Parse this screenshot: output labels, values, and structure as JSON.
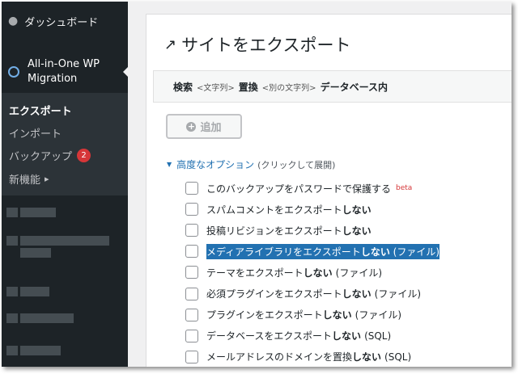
{
  "sidebar": {
    "dashboard": "ダッシュボード",
    "plugin": "All-in-One WP Migration",
    "submenu": {
      "export": "エクスポート",
      "import": "インポート",
      "backup": "バックアップ",
      "backup_count": "2",
      "new_features": "新機能"
    }
  },
  "main": {
    "title": "サイトをエクスポート",
    "search": {
      "search_label": "検索",
      "search_placeholder": "<文字列>",
      "replace_label": "置換",
      "replace_placeholder": "<別の文字列>",
      "suffix": "データベース内"
    },
    "add_button": "追加",
    "advanced": {
      "label": "高度なオプション",
      "hint": "(クリックして展開)"
    },
    "options": [
      {
        "text": "このバックアップをパスワードで保護する",
        "bold": "",
        "paren": "",
        "beta": "beta"
      },
      {
        "text": "スパムコメントをエクスポート",
        "bold": "しない",
        "paren": "",
        "beta": ""
      },
      {
        "text": "投稿リビジョンをエクスポート",
        "bold": "しない",
        "paren": "",
        "beta": ""
      },
      {
        "text": "メディアライブラリをエクスポート",
        "bold": "しない",
        "paren": "(ファイル)",
        "beta": "",
        "highlighted": true
      },
      {
        "text": "テーマをエクスポート",
        "bold": "しない",
        "paren": "(ファイル)",
        "beta": ""
      },
      {
        "text": "必須プラグインをエクスポート",
        "bold": "しない",
        "paren": "(ファイル)",
        "beta": ""
      },
      {
        "text": "プラグインをエクスポート",
        "bold": "しない",
        "paren": "(ファイル)",
        "beta": ""
      },
      {
        "text": "データベースをエクスポート",
        "bold": "しない",
        "paren": "(SQL)",
        "beta": ""
      },
      {
        "text": "メールアドレスのドメインを置換",
        "bold": "しない",
        "paren": "(SQL)",
        "beta": ""
      }
    ]
  },
  "colors": {
    "sidebar_bg": "#1d2327",
    "submenu_bg": "#2c3338",
    "accent": "#2271b1",
    "badge": "#d63638"
  }
}
